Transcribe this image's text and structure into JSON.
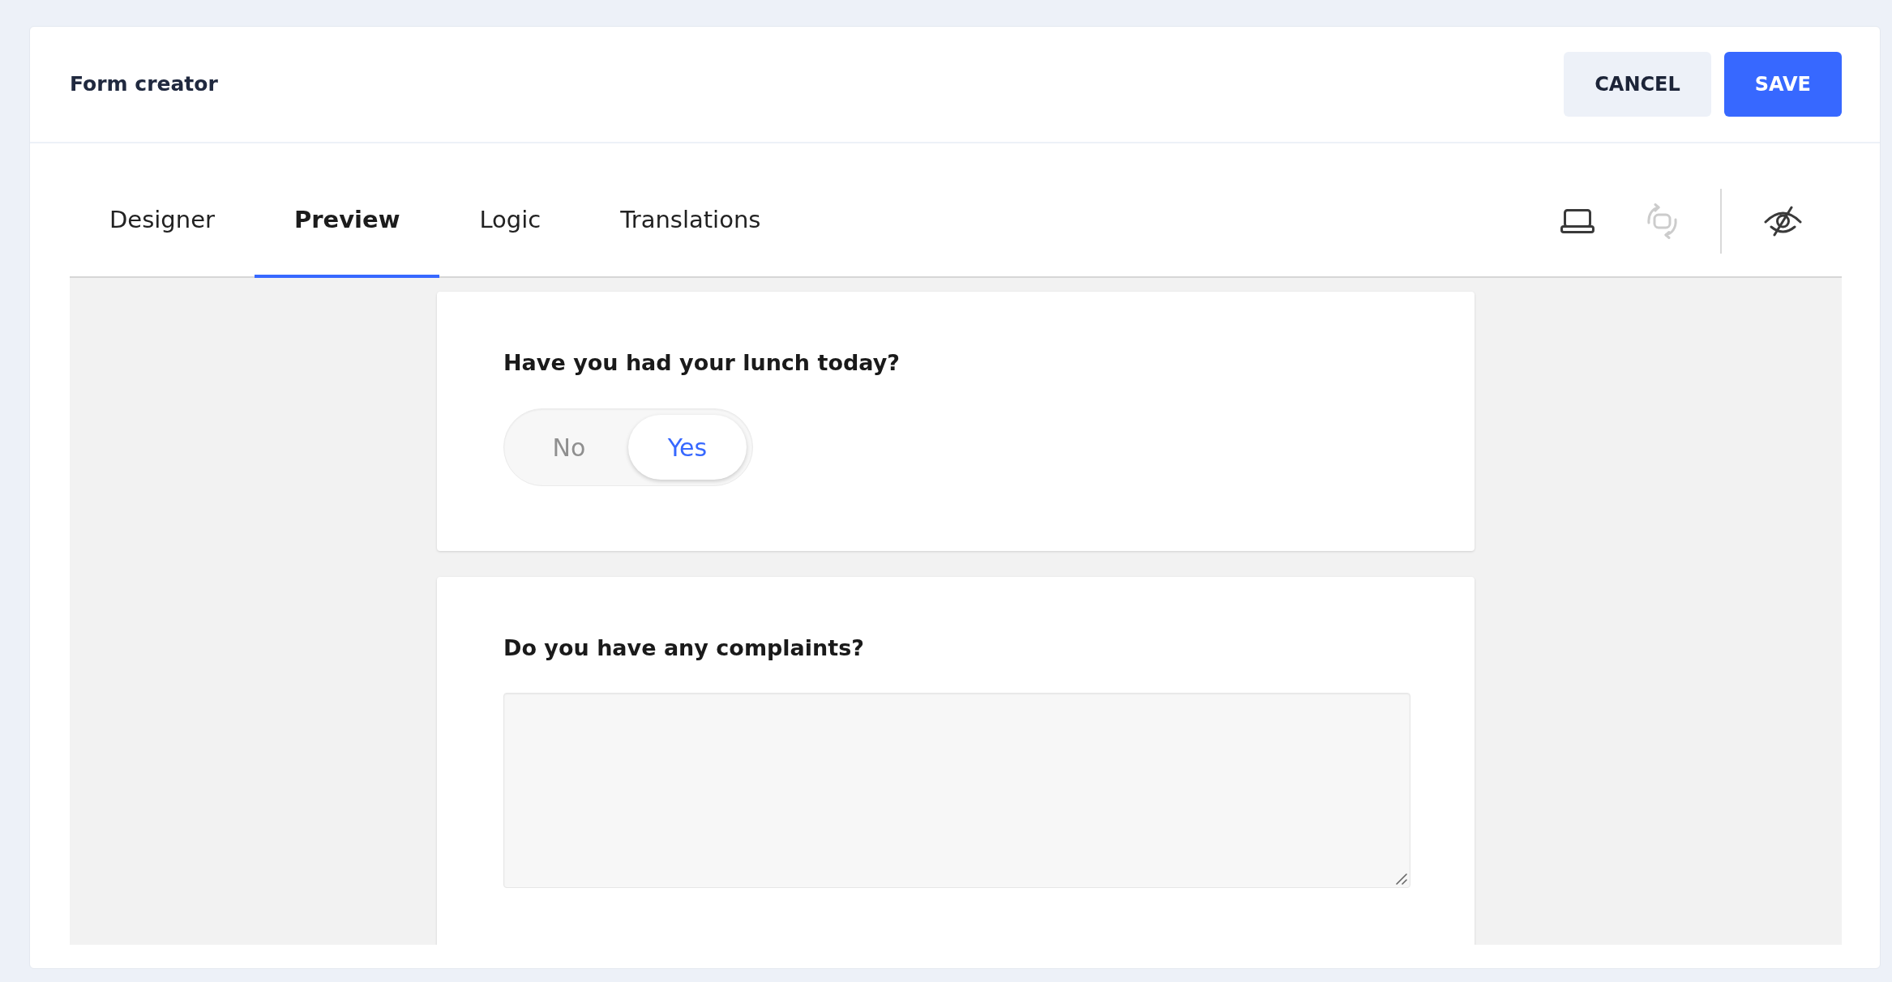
{
  "header": {
    "title": "Form creator",
    "buttons": [
      {
        "label": "CANCEL",
        "kind": "cancel"
      },
      {
        "label": "SAVE",
        "kind": "save"
      }
    ]
  },
  "tabs": [
    {
      "label": "Designer",
      "selected": false
    },
    {
      "label": "Preview",
      "selected": true
    },
    {
      "label": "Logic",
      "selected": false
    },
    {
      "label": "Translations",
      "selected": false
    }
  ],
  "toolbar": [
    {
      "kind": "laptop",
      "disabled": false
    },
    {
      "kind": "rotate",
      "disabled": true
    },
    {
      "kind": "separator"
    },
    {
      "kind": "eye-off",
      "disabled": false
    }
  ],
  "questions": [
    {
      "kind": "boolean",
      "title": "Have you had your lunch today?",
      "options": [
        {
          "label": "No",
          "selected": false
        },
        {
          "label": "Yes",
          "selected": true
        }
      ]
    },
    {
      "kind": "comment",
      "title": "Do you have any complaints?"
    }
  ]
}
